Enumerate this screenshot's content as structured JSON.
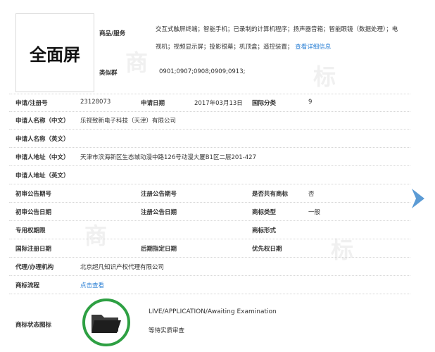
{
  "watermarks": [
    "商",
    "标",
    "商",
    "标"
  ],
  "mark": {
    "image_text": "全面屏"
  },
  "header": {
    "goods_label": "商品/服务",
    "goods_text": "交互式触屏终端；智能手机；已录制的计算机程序；扬声器音箱；智能眼镜（数据处理）；电视机；视频显示屏；投影银幕；机顶盒；遥控装置；",
    "goods_more": "查看详细信息",
    "similar_label": "类似群",
    "similar_value": "0901;0907;0908;0909;0913;"
  },
  "details": {
    "reg_no_label": "申请/注册号",
    "reg_no": "23128073",
    "app_date_label": "申请日期",
    "app_date": "2017年03月13日",
    "intl_class_label": "国际分类",
    "intl_class": "9",
    "applicant_cn_label": "申请人名称（中文）",
    "applicant_cn": "乐视致新电子科技（天津）有限公司",
    "applicant_en_label": "申请人名称（英文）",
    "address_cn_label": "申请人地址（中文）",
    "address_cn": "天津市滨海新区生态城动漫中路126号动漫大厦B1区二层201-427",
    "address_en_label": "申请人地址（英文）",
    "prelim_no_label": "初审公告期号",
    "reg_pub_no_label": "注册公告期号",
    "shared_label": "是否共有商标",
    "shared": "否",
    "prelim_date_label": "初审公告日期",
    "reg_pub_date_label": "注册公告日期",
    "mark_type_label": "商标类型",
    "mark_type": "一般",
    "exclusive_label": "专用权期限",
    "mark_form_label": "商标形式",
    "intl_reg_date_label": "国际注册日期",
    "later_date_label": "后期指定日期",
    "priority_label": "优先权日期",
    "agent_label": "代理/办理机构",
    "agent": "北京超凡知识产权代理有限公司",
    "process_label": "商标流程",
    "process_link": "点击查看",
    "status_label": "商标状态图标",
    "status_en": "LIVE/APPLICATION/Awaiting Examination",
    "status_cn": "等待实质审查"
  },
  "colors": {
    "link": "#2a7fd4",
    "status_ring": "#2ea043",
    "arrow": "#5b9bd5"
  },
  "icons": {
    "next": "chevron-right-icon",
    "status": "folder-icon"
  }
}
